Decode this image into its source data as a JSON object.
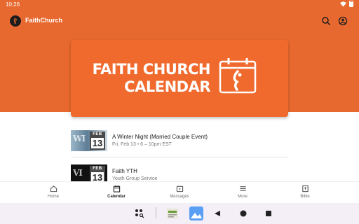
{
  "status": {
    "time": "10:26"
  },
  "app": {
    "title": "FaithChurch"
  },
  "banner": {
    "line1": "FAITH CHURCH",
    "line2": "CALENDAR"
  },
  "events": [
    {
      "title": "A Winter Night (Married Couple Event)",
      "subtitle": "Fri, Feb 13 • 6 – 10pm EST",
      "month": "FEB",
      "day": "13",
      "thumb_text": "WI"
    },
    {
      "title": "Faith YTH",
      "subtitle": "Youth Group Service",
      "thumb_text": "VI",
      "month": "FEB",
      "day": "13"
    }
  ],
  "nav": [
    {
      "label": "Home",
      "icon": "home-icon"
    },
    {
      "label": "Calendar",
      "icon": "calendar-icon",
      "active": true
    },
    {
      "label": "Messages",
      "icon": "messages-icon"
    },
    {
      "label": "More",
      "icon": "more-icon"
    },
    {
      "label": "Bible",
      "icon": "bible-icon"
    }
  ],
  "colors": {
    "brand": "#e8692f",
    "banner": "#f06a2d"
  }
}
